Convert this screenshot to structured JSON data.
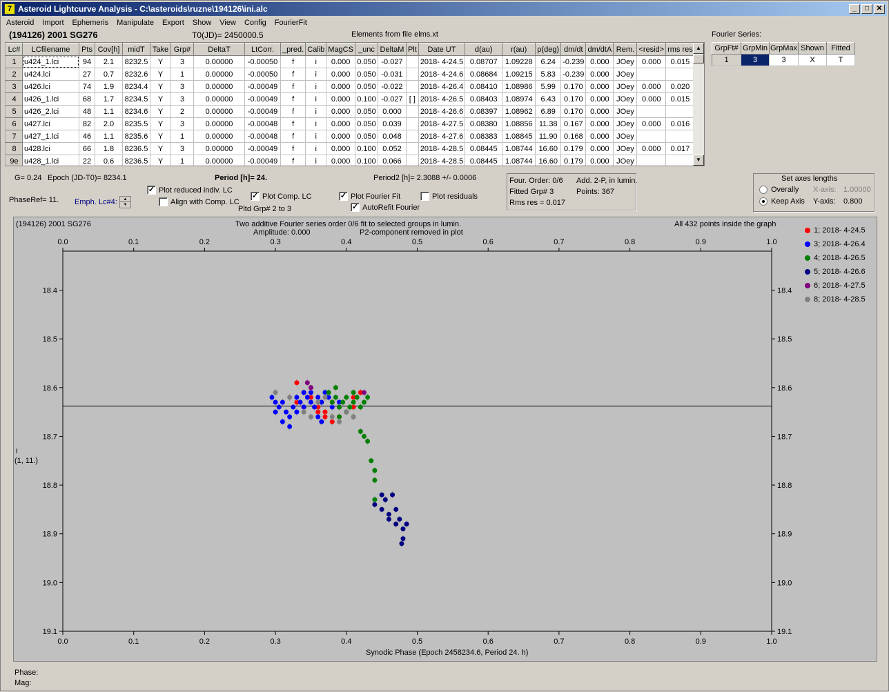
{
  "window": {
    "title": "Asteroid Lightcurve Analysis - C:\\asteroids\\ruzne\\194126\\ini.alc",
    "app_icon": "7",
    "minimize": "_",
    "maximize": "□",
    "close": "✕"
  },
  "menu": [
    "Asteroid",
    "Import",
    "Ephemeris",
    "Manipulate",
    "Export",
    "Show",
    "View",
    "Config",
    "FourierFit"
  ],
  "header": {
    "asteroid": "(194126) 2001 SG276",
    "t0": "T0(JD)= 2450000.5",
    "elements": "Elements from file elms.xt"
  },
  "table": {
    "columns": [
      "Lc#",
      "LCfilename",
      "Pts",
      "Cov[h]",
      "midT",
      "Take",
      "Grp#",
      "DeltaT",
      "LtCorr.",
      "_pred.",
      "Calib",
      "MagCS",
      "_unc",
      "DeltaM",
      "Plt",
      "Date UT",
      "d(au)",
      "r(au)",
      "p(deg)",
      "dm/dt",
      "dm/dtA",
      "Rem.",
      "<resid>",
      "rms res"
    ],
    "rows": [
      [
        "1",
        "u424_1.lci",
        "94",
        "2.1",
        "8232.5",
        "Y",
        "3",
        "0.00000",
        "-0.00050",
        "f",
        "i",
        "0.000",
        "0.050",
        "-0.027",
        "",
        "2018- 4-24.5",
        "0.08707",
        "1.09228",
        "6.24",
        "-0.239",
        "0.000",
        "JOey",
        "0.000",
        "0.015"
      ],
      [
        "2",
        "u424.lci",
        "27",
        "0.7",
        "8232.6",
        "Y",
        "1",
        "0.00000",
        "-0.00050",
        "f",
        "i",
        "0.000",
        "0.050",
        "-0.031",
        "",
        "2018- 4-24.6",
        "0.08684",
        "1.09215",
        "5.83",
        "-0.239",
        "0.000",
        "JOey",
        "",
        ""
      ],
      [
        "3",
        "u426.lci",
        "74",
        "1.9",
        "8234.4",
        "Y",
        "3",
        "0.00000",
        "-0.00049",
        "f",
        "i",
        "0.000",
        "0.050",
        "-0.022",
        "",
        "2018- 4-26.4",
        "0.08410",
        "1.08986",
        "5.99",
        "0.170",
        "0.000",
        "JOey",
        "0.000",
        "0.020"
      ],
      [
        "4",
        "u426_1.lci",
        "68",
        "1.7",
        "8234.5",
        "Y",
        "3",
        "0.00000",
        "-0.00049",
        "f",
        "i",
        "0.000",
        "0.100",
        "-0.027",
        "[ ]",
        "2018- 4-26.5",
        "0.08403",
        "1.08974",
        "6.43",
        "0.170",
        "0.000",
        "JOey",
        "0.000",
        "0.015"
      ],
      [
        "5",
        "u426_2.lci",
        "48",
        "1.1",
        "8234.6",
        "Y",
        "2",
        "0.00000",
        "-0.00049",
        "f",
        "i",
        "0.000",
        "0.050",
        "0.000",
        "",
        "2018- 4-26.6",
        "0.08397",
        "1.08962",
        "6.89",
        "0.170",
        "0.000",
        "JOey",
        "",
        ""
      ],
      [
        "6",
        "u427.lci",
        "82",
        "2.0",
        "8235.5",
        "Y",
        "3",
        "0.00000",
        "-0.00048",
        "f",
        "i",
        "0.000",
        "0.050",
        "0.039",
        "",
        "2018- 4-27.5",
        "0.08380",
        "1.08856",
        "11.38",
        "0.167",
        "0.000",
        "JOey",
        "0.000",
        "0.016"
      ],
      [
        "7",
        "u427_1.lci",
        "46",
        "1.1",
        "8235.6",
        "Y",
        "1",
        "0.00000",
        "-0.00048",
        "f",
        "i",
        "0.000",
        "0.050",
        "0.048",
        "",
        "2018- 4-27.6",
        "0.08383",
        "1.08845",
        "11.90",
        "0.168",
        "0.000",
        "JOey",
        "",
        ""
      ],
      [
        "8",
        "u428.lci",
        "66",
        "1.8",
        "8236.5",
        "Y",
        "3",
        "0.00000",
        "-0.00049",
        "f",
        "i",
        "0.000",
        "0.100",
        "0.052",
        "",
        "2018- 4-28.5",
        "0.08445",
        "1.08744",
        "16.60",
        "0.179",
        "0.000",
        "JOey",
        "0.000",
        "0.017"
      ],
      [
        "9e",
        "u428_1.lci",
        "22",
        "0.6",
        "8236.5",
        "Y",
        "1",
        "0.00000",
        "-0.00049",
        "f",
        "i",
        "0.000",
        "0.100",
        "0.066",
        "",
        "2018- 4-28.5",
        "0.08445",
        "1.08744",
        "16.60",
        "0.179",
        "0.000",
        "JOey",
        "",
        ""
      ]
    ]
  },
  "fourier": {
    "title": "Fourier Series:",
    "columns": [
      "GrpFt#",
      "GrpMin",
      "GrpMax",
      "Shown",
      "Fitted"
    ],
    "row": [
      "1",
      "3",
      "3",
      "X",
      "T"
    ]
  },
  "controls": {
    "g": "G= 0.24",
    "epoch": "Epoch (JD-T0)= 8234.1",
    "period": "Period [h]= 24.",
    "period2": "Period2 [h]= 2.3088 +/- 0.0006",
    "phaseref": "PhaseRef= 11.",
    "emph": "Emph. Lc#4:",
    "plot_reduced": "Plot reduced indiv. LC",
    "align": "Align with Comp. LC",
    "plot_comp": "Plot Comp. LC",
    "pltd_grp": "Pltd Grp#  2  to   3",
    "plot_fourier": "Plot Fourier Fit",
    "autorefit": "AutoRefit Fourier",
    "plot_residuals": "Plot residuals",
    "check": "✓"
  },
  "fitinfo": {
    "order": "Four. Order:  0/6",
    "add": "Add. 2-P, in lumin.",
    "fitted": "Fitted Grp# 3",
    "points": "Points: 367",
    "rms": "Rms res      = 0.017"
  },
  "axes": {
    "title": "Set axes lengths",
    "overally": "Overally",
    "keep": "Keep Axis",
    "xaxis_label": "X-axis:",
    "xaxis_val": "1.00000",
    "yaxis_label": "Y-axis:",
    "yaxis_val": "0.800"
  },
  "plot": {
    "name": "(194126) 2001 SG276",
    "line1": "Two additive Fourier series order 0/6 fit to selected groups in lumin.",
    "amplitude": "Amplitude: 0.000",
    "p2": "P2-component removed in plot",
    "inside": "All 432 points inside the graph",
    "xlabel": "Synodic Phase (Epoch 2458234.6, Period 24. h)",
    "ylabel1": "i",
    "ylabel2": "(1, 11.)"
  },
  "legend": [
    {
      "label": "1; 2018- 4-24.5",
      "color": "#ff0000"
    },
    {
      "label": "3; 2018- 4-26.4",
      "color": "#0000ff"
    },
    {
      "label": "4; 2018- 4-26.5",
      "color": "#008000"
    },
    {
      "label": "5; 2018- 4-26.6",
      "color": "#000080"
    },
    {
      "label": "6; 2018- 4-27.5",
      "color": "#800080"
    },
    {
      "label": "8; 2018- 4-28.5",
      "color": "#808080"
    }
  ],
  "status": {
    "phase": "Phase:",
    "mag": "Mag:"
  },
  "chart_data": {
    "type": "scatter",
    "xlim": [
      0,
      1
    ],
    "ylim": [
      19.1,
      18.32
    ],
    "xticks": [
      "0.0",
      "0.1",
      "0.2",
      "0.3",
      "0.4",
      "0.5",
      "0.6",
      "0.7",
      "0.8",
      "0.9",
      "1.0"
    ],
    "yticks": [
      "18.4",
      "18.5",
      "18.6",
      "18.7",
      "18.8",
      "18.9",
      "19.0",
      "19.1"
    ],
    "fit_line": 18.638,
    "series": [
      {
        "name": "1; 2018- 4-24.5",
        "color": "#ff0000",
        "points": [
          [
            0.33,
            18.63
          ],
          [
            0.34,
            18.61
          ],
          [
            0.35,
            18.62
          ],
          [
            0.36,
            18.64
          ],
          [
            0.37,
            18.65
          ],
          [
            0.38,
            18.63
          ],
          [
            0.39,
            18.64
          ],
          [
            0.4,
            18.65
          ],
          [
            0.41,
            18.62
          ],
          [
            0.42,
            18.61
          ],
          [
            0.37,
            18.66
          ],
          [
            0.36,
            18.65
          ],
          [
            0.38,
            18.67
          ],
          [
            0.34,
            18.64
          ],
          [
            0.33,
            18.59
          ],
          [
            0.41,
            18.64
          ],
          [
            0.39,
            18.66
          ],
          [
            0.35,
            18.6
          ]
        ]
      },
      {
        "name": "3; 2018- 4-26.4",
        "color": "#0000ff",
        "points": [
          [
            0.295,
            18.62
          ],
          [
            0.3,
            18.63
          ],
          [
            0.305,
            18.64
          ],
          [
            0.31,
            18.63
          ],
          [
            0.315,
            18.65
          ],
          [
            0.32,
            18.66
          ],
          [
            0.325,
            18.64
          ],
          [
            0.33,
            18.62
          ],
          [
            0.335,
            18.63
          ],
          [
            0.34,
            18.61
          ],
          [
            0.345,
            18.62
          ],
          [
            0.35,
            18.63
          ],
          [
            0.355,
            18.64
          ],
          [
            0.36,
            18.62
          ],
          [
            0.365,
            18.63
          ],
          [
            0.37,
            18.61
          ],
          [
            0.375,
            18.62
          ],
          [
            0.3,
            18.65
          ],
          [
            0.31,
            18.67
          ],
          [
            0.32,
            18.68
          ],
          [
            0.34,
            18.64
          ],
          [
            0.36,
            18.66
          ],
          [
            0.365,
            18.67
          ],
          [
            0.35,
            18.61
          ],
          [
            0.38,
            18.64
          ],
          [
            0.39,
            18.63
          ],
          [
            0.33,
            18.65
          ]
        ]
      },
      {
        "name": "4; 2018- 4-26.5",
        "color": "#008000",
        "points": [
          [
            0.375,
            18.61
          ],
          [
            0.38,
            18.63
          ],
          [
            0.385,
            18.62
          ],
          [
            0.39,
            18.64
          ],
          [
            0.395,
            18.63
          ],
          [
            0.4,
            18.62
          ],
          [
            0.405,
            18.64
          ],
          [
            0.41,
            18.63
          ],
          [
            0.415,
            18.62
          ],
          [
            0.42,
            18.64
          ],
          [
            0.425,
            18.63
          ],
          [
            0.43,
            18.62
          ],
          [
            0.4,
            18.65
          ],
          [
            0.39,
            18.66
          ],
          [
            0.41,
            18.66
          ],
          [
            0.42,
            18.69
          ],
          [
            0.425,
            18.7
          ],
          [
            0.43,
            18.71
          ],
          [
            0.435,
            18.75
          ],
          [
            0.44,
            18.77
          ],
          [
            0.44,
            18.79
          ],
          [
            0.385,
            18.6
          ],
          [
            0.41,
            18.61
          ],
          [
            0.44,
            18.83
          ]
        ]
      },
      {
        "name": "5; 2018- 4-26.6",
        "color": "#000080",
        "points": [
          [
            0.44,
            18.84
          ],
          [
            0.45,
            18.85
          ],
          [
            0.455,
            18.83
          ],
          [
            0.46,
            18.86
          ],
          [
            0.465,
            18.82
          ],
          [
            0.47,
            18.85
          ],
          [
            0.475,
            18.87
          ],
          [
            0.48,
            18.89
          ],
          [
            0.48,
            18.91
          ],
          [
            0.485,
            18.88
          ],
          [
            0.478,
            18.92
          ],
          [
            0.46,
            18.87
          ],
          [
            0.45,
            18.82
          ],
          [
            0.47,
            18.88
          ]
        ]
      },
      {
        "name": "6; 2018- 4-27.5",
        "color": "#800080",
        "points": [
          [
            0.345,
            18.59
          ],
          [
            0.35,
            18.6
          ],
          [
            0.425,
            18.61
          ]
        ]
      },
      {
        "name": "8; 2018- 4-28.5",
        "color": "#808080",
        "points": [
          [
            0.3,
            18.61
          ],
          [
            0.32,
            18.62
          ],
          [
            0.34,
            18.65
          ],
          [
            0.36,
            18.63
          ],
          [
            0.37,
            18.62
          ],
          [
            0.38,
            18.66
          ],
          [
            0.39,
            18.67
          ],
          [
            0.4,
            18.65
          ],
          [
            0.41,
            18.66
          ],
          [
            0.35,
            18.66
          ]
        ]
      }
    ]
  }
}
